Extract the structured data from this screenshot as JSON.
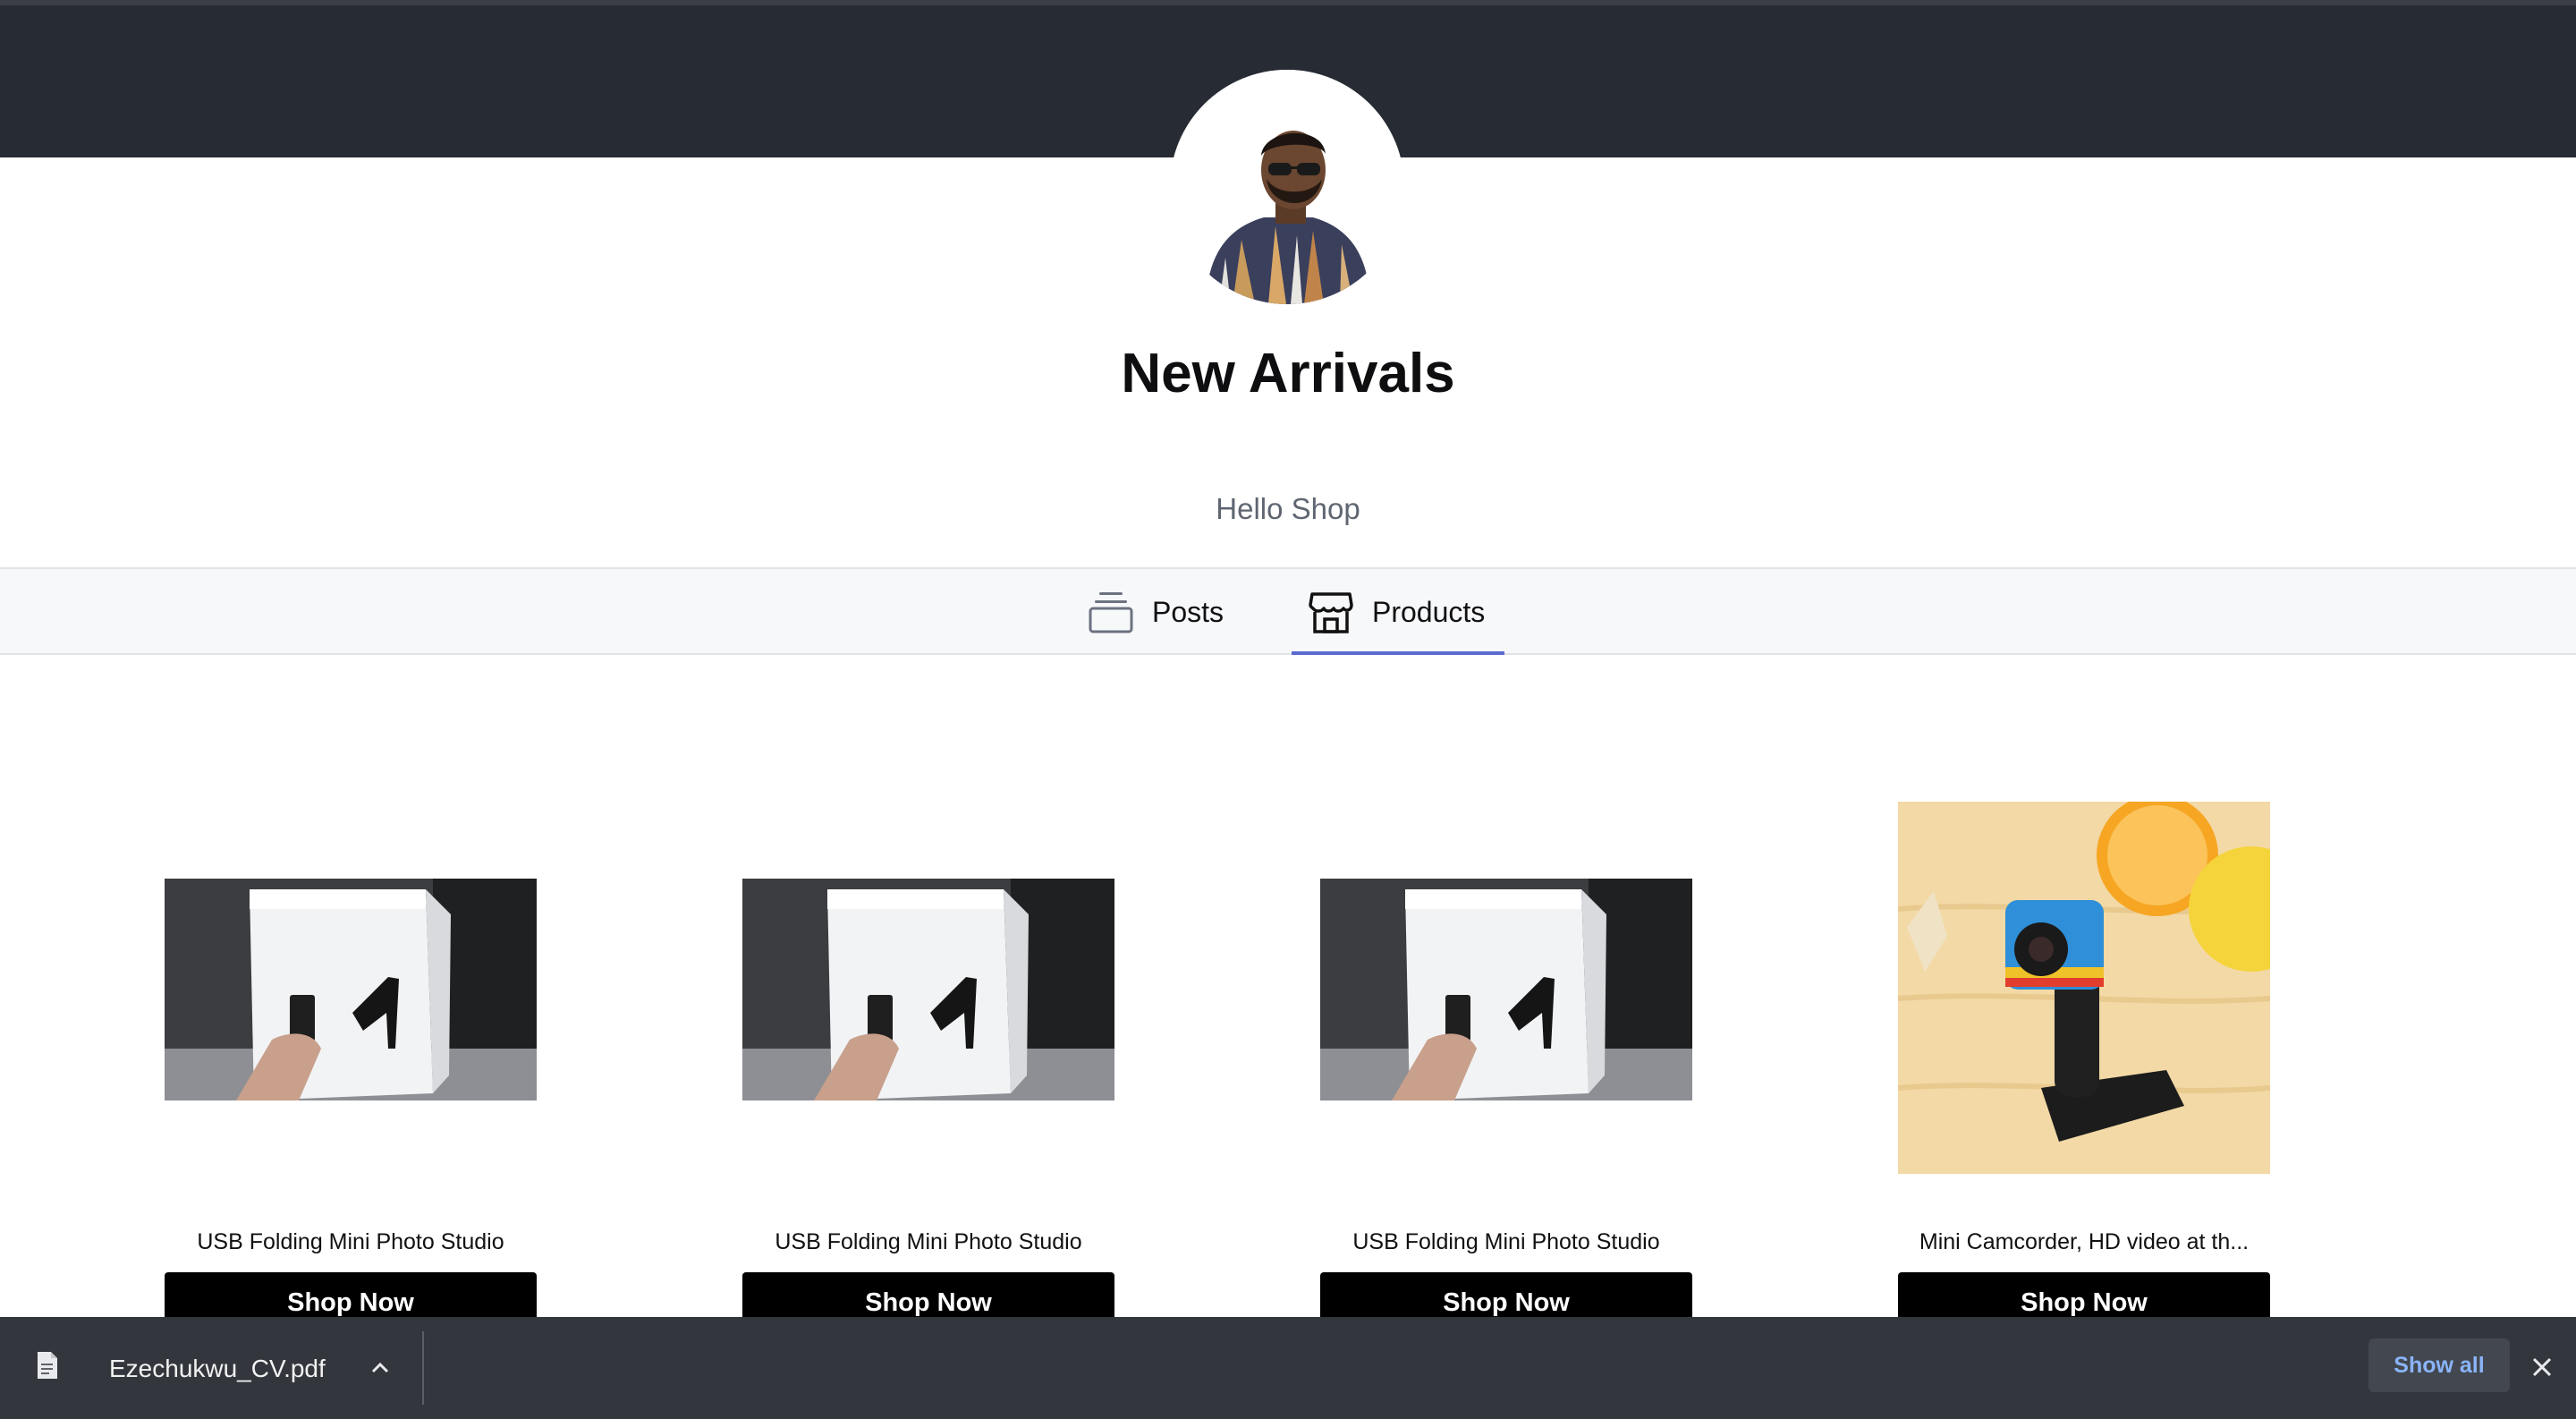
{
  "header": {
    "title": "New Arrivals",
    "subtitle": "Hello Shop"
  },
  "tabs": [
    {
      "label": "Posts",
      "icon": "posts-stack-icon",
      "active": false
    },
    {
      "label": "Products",
      "icon": "store-icon",
      "active": true
    }
  ],
  "products": [
    {
      "name": "USB Folding Mini Photo Studio",
      "button": "Shop Now",
      "image": "photo-studio-image"
    },
    {
      "name": "USB Folding Mini Photo Studio",
      "button": "Shop Now",
      "image": "photo-studio-image"
    },
    {
      "name": "USB Folding Mini Photo Studio",
      "button": "Shop Now",
      "image": "photo-studio-image"
    },
    {
      "name": "Mini Camcorder, HD video at th...",
      "button": "Shop Now",
      "image": "mini-camcorder-image"
    }
  ],
  "download_bar": {
    "filename": "Ezechukwu_CV.pdf",
    "show_all": "Show all"
  },
  "colors": {
    "header_bg": "#272c34",
    "tab_underline": "#5a6ad0",
    "button_bg": "#000000",
    "download_bar_bg": "#33363c",
    "show_all_text": "#8ab4f8"
  }
}
